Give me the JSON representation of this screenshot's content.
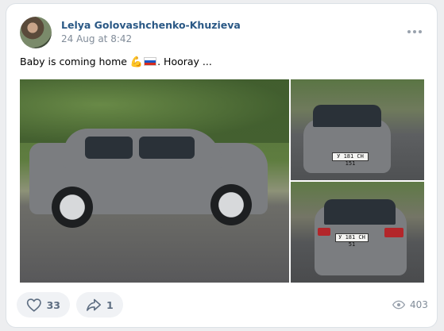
{
  "post": {
    "author": "Lelya Golovashchenko-Khuzieva",
    "date": "24 Aug at 8:42",
    "text_before": "Baby is coming home ",
    "text_after": ". Hooray ...",
    "emoji": [
      "flexed-biceps",
      "russian-flag"
    ],
    "plates": {
      "side": "",
      "front": "У 181 СН 151",
      "rear": "У 181 СН 51"
    }
  },
  "actions": {
    "likes": "33",
    "shares": "1",
    "views": "403"
  }
}
